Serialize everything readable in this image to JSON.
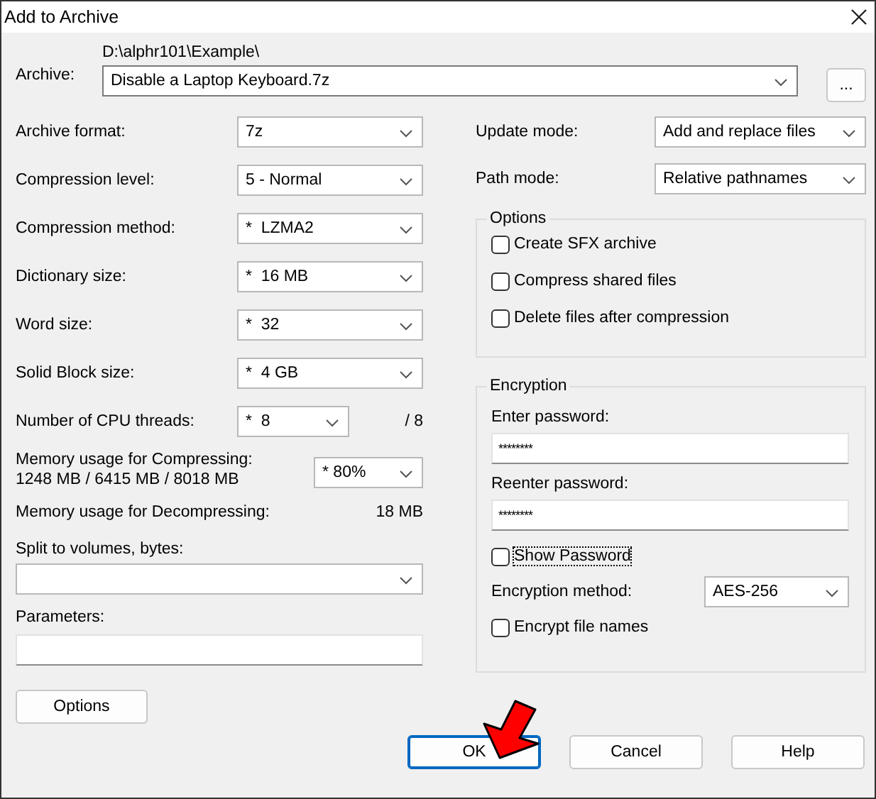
{
  "window": {
    "title": "Add to Archive"
  },
  "archive": {
    "label": "Archive:",
    "path": "D:\\alphr101\\Example\\",
    "value": "Disable a Laptop Keyboard.7z",
    "browse": "..."
  },
  "left_fields": [
    {
      "label": "Archive format:",
      "value": "7z"
    },
    {
      "label": "Compression level:",
      "value": "5 - Normal"
    },
    {
      "label": "Compression method:",
      "value": "*  LZMA2"
    },
    {
      "label": "Dictionary size:",
      "value": "*  16 MB"
    },
    {
      "label": "Word size:",
      "value": "*  32"
    },
    {
      "label": "Solid Block size:",
      "value": "*  4 GB"
    }
  ],
  "threads": {
    "label": "Number of CPU threads:",
    "value": "*  8",
    "max": "/ 8"
  },
  "memory": {
    "label": "Memory usage for Compressing:",
    "detail": "1248 MB / 6415 MB / 8018 MB",
    "value": "* 80%",
    "decompress_label": "Memory usage for Decompressing:",
    "decompress_value": "18 MB"
  },
  "split": {
    "label": "Split to volumes, bytes:"
  },
  "parameters": {
    "label": "Parameters:"
  },
  "options_button": "Options",
  "right_fields": [
    {
      "label": "Update mode:",
      "value": "Add and replace files"
    },
    {
      "label": "Path mode:",
      "value": "Relative pathnames"
    }
  ],
  "options_group": {
    "title": "Options",
    "items": [
      {
        "label": "Create SFX archive",
        "checked": false
      },
      {
        "label": "Compress shared files",
        "checked": false
      },
      {
        "label": "Delete files after compression",
        "checked": false
      }
    ]
  },
  "encryption": {
    "title": "Encryption",
    "enter_label": "Enter password:",
    "enter_value": "********",
    "reenter_label": "Reenter password:",
    "reenter_value": "********",
    "show_password": {
      "label": "Show Password",
      "checked": false,
      "focused": true
    },
    "method_label": "Encryption method:",
    "method_value": "AES-256",
    "encrypt_names": {
      "label": "Encrypt file names",
      "checked": false
    }
  },
  "buttons": [
    {
      "label": "OK",
      "default": true
    },
    {
      "label": "Cancel",
      "default": false
    },
    {
      "label": "Help",
      "default": false
    }
  ]
}
